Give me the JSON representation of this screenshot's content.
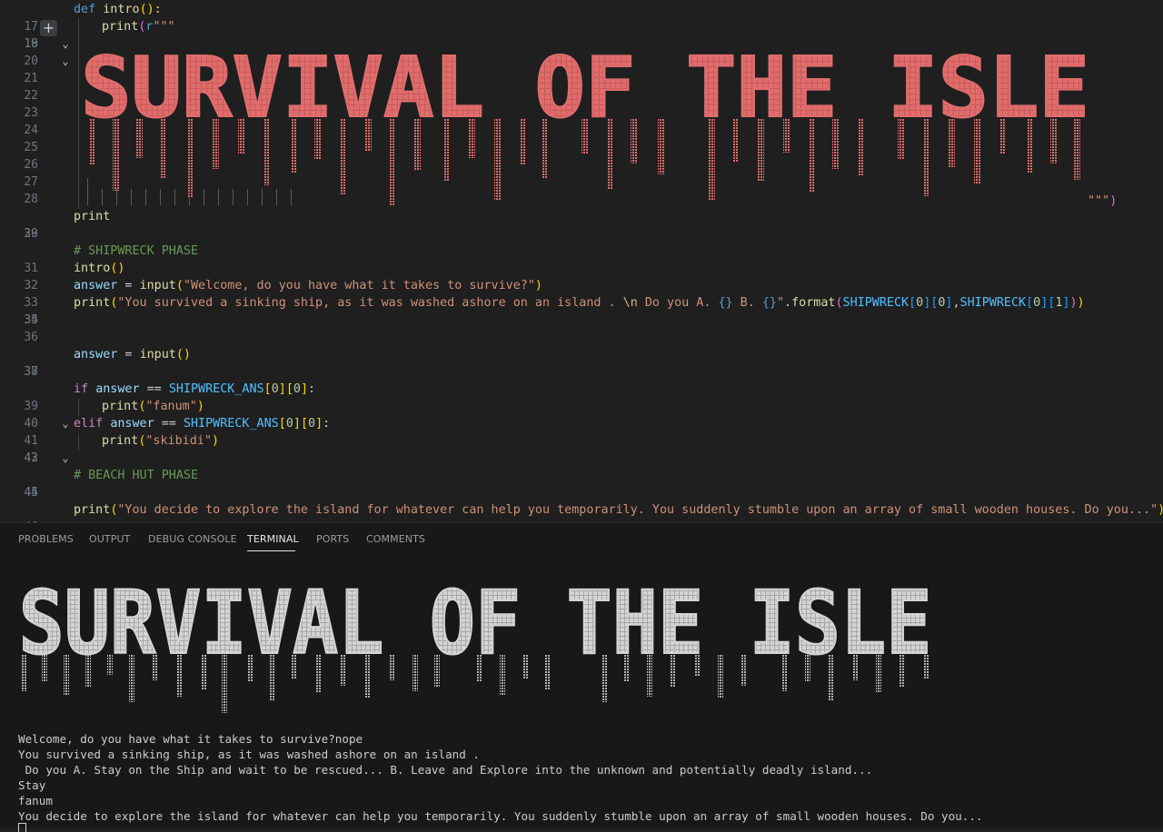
{
  "editor": {
    "line_numbers": [
      "17",
      "18",
      "19",
      "20",
      "21",
      "22",
      "23",
      "24",
      "25",
      "26",
      "27",
      "28",
      "29",
      "30",
      "31",
      "32",
      "33",
      "34",
      "35",
      "36",
      "37",
      "38",
      "39",
      "40",
      "41",
      "42",
      "43",
      "44",
      "45",
      "46"
    ],
    "def_keyword": "def",
    "intro_fn_name": "intro",
    "def_tail": "():",
    "print_fn": "print",
    "raw_prefix": "r",
    "triple_quote_open": "\"\"\"",
    "triple_quote_close": "\"\"\"",
    "banner_text": "SURVIVAL OF THE ISLE",
    "line29": "print",
    "comment_shipwreck": "# SHIPWRECK PHASE",
    "intro_call": "intro",
    "answer_var": "answer",
    "input_fn": "input",
    "welcome_prompt": "\"Welcome, do you have what it takes to survive?\"",
    "line34_str_a": "\"You survived a sinking ship, as it was washed ashore on an island . ",
    "line34_escape": "\\n",
    "line34_str_b": " Do you A. ",
    "line34_braces1": "{}",
    "line34_str_c": " B. ",
    "line34_braces2": "{}",
    "line34_str_d": "\"",
    "format_fn": "format",
    "shipwreck_const": "SHIPWRECK",
    "shipwreck_ans_const": "SHIPWRECK_ANS",
    "zero": "0",
    "one": "1",
    "if_kw": "if",
    "elif_kw": "elif",
    "eq_op": " == ",
    "fanum_str": "\"fanum\"",
    "skibidi_str": "\"skibidi\"",
    "comment_beach": "# BEACH HUT PHASE",
    "line46_str": "\"You decide to explore the island for whatever can help you temporarily. You suddenly stumble upon an array of small wooden houses. Do you...\""
  },
  "panel": {
    "tabs": [
      "PROBLEMS",
      "OUTPUT",
      "DEBUG CONSOLE",
      "TERMINAL",
      "PORTS",
      "COMMENTS"
    ],
    "active_tab": "TERMINAL"
  },
  "terminal": {
    "banner_text": "SURVIVAL OF THE ISLE",
    "lines": [
      "Welcome, do you have what it takes to survive?nope",
      "You survived a sinking ship, as it was washed ashore on an island .",
      " Do you A. Stay on the Ship and wait to be rescued... B. Leave and Explore into the unknown and potentially deadly island...",
      "Stay",
      "fanum",
      "You decide to explore the island for whatever can help you temporarily. You suddenly stumble upon an array of small wooden houses. Do you..."
    ]
  },
  "colors": {
    "editor_banner": "#e06c6c",
    "terminal_banner": "#d4d4d4"
  }
}
